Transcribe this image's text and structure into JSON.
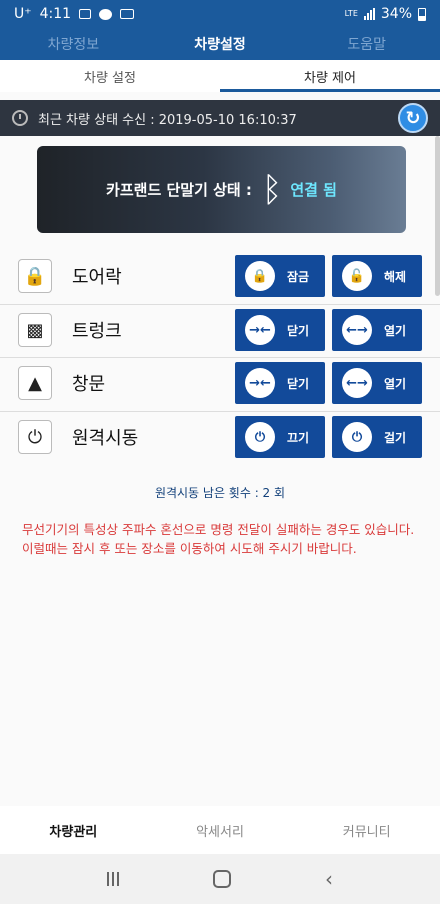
{
  "status_bar": {
    "carrier": "U⁺",
    "time": "4:11",
    "network": "LTE",
    "battery": "34%"
  },
  "top_tabs": [
    {
      "label": "차량정보",
      "active": false
    },
    {
      "label": "차량설정",
      "active": true
    },
    {
      "label": "도움말",
      "active": false
    }
  ],
  "sub_tabs": [
    {
      "label": "차량 설정",
      "active": false
    },
    {
      "label": "차량 제어",
      "active": true
    }
  ],
  "recv_status": {
    "text": "최근 차량 상태 수신 : 2019-05-10 16:10:37"
  },
  "banner": {
    "prefix": "카프랜드 단말기 상태 :",
    "status": "연결 됨"
  },
  "controls": [
    {
      "label": "도어락",
      "icon": "lock-icon",
      "buttons": [
        {
          "label": "잠금",
          "icon": "lock-closed-icon"
        },
        {
          "label": "해제",
          "icon": "lock-open-icon"
        }
      ]
    },
    {
      "label": "트렁크",
      "icon": "trunk-icon",
      "buttons": [
        {
          "label": "닫기",
          "icon": "close-arrows-icon"
        },
        {
          "label": "열기",
          "icon": "open-arrows-icon"
        }
      ]
    },
    {
      "label": "창문",
      "icon": "window-icon",
      "buttons": [
        {
          "label": "닫기",
          "icon": "close-arrows-icon"
        },
        {
          "label": "열기",
          "icon": "open-arrows-icon"
        }
      ]
    },
    {
      "label": "원격시동",
      "icon": "remote-start-icon",
      "buttons": [
        {
          "label": "끄기",
          "icon": "power-icon"
        },
        {
          "label": "걸기",
          "icon": "power-icon"
        }
      ]
    }
  ],
  "remaining": {
    "text": "원격시동 남은 횟수 : 2 회"
  },
  "warning": {
    "text": "무선기기의 특성상 주파수 혼선으로 명령 전달이 실패하는 경우도 있습니다. 이럴때는 잠시 후  또는 장소를 이동하여 시도해 주시기 바랍니다."
  },
  "bottom_nav": [
    {
      "label": "차량관리",
      "active": true
    },
    {
      "label": "악세서리",
      "active": false
    },
    {
      "label": "커뮤니티",
      "active": false
    }
  ],
  "colors": {
    "primary": "#1b5a9c",
    "button": "#124a9a",
    "warning": "#d93a3a"
  }
}
